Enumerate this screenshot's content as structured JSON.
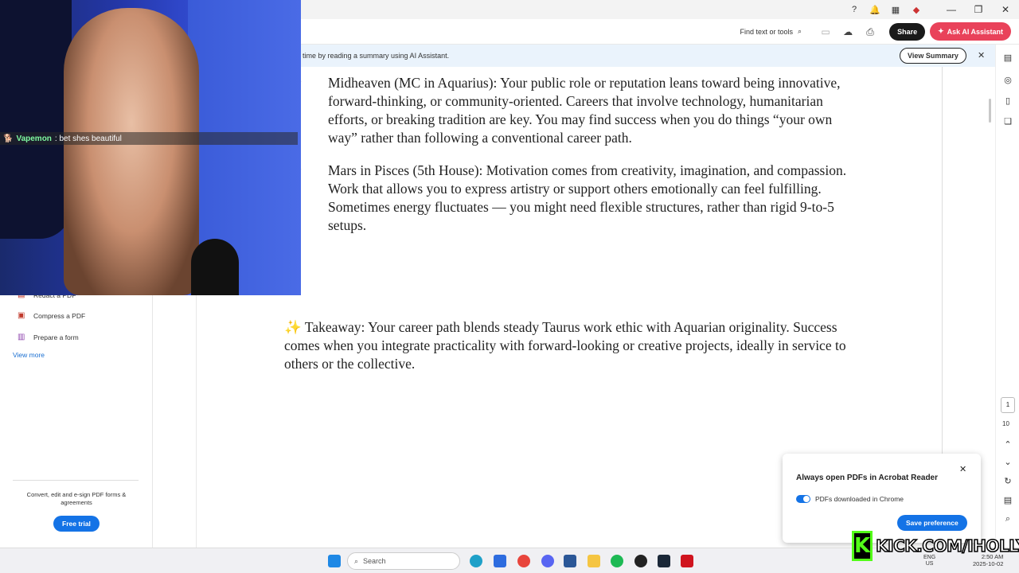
{
  "toolbar": {
    "find_label": "Find text or tools",
    "share_label": "Share",
    "ai_label": "Ask AI Assistant"
  },
  "banner": {
    "text": "time by reading a summary using AI Assistant.",
    "view_summary": "View Summary"
  },
  "left_panel": {
    "items": [
      {
        "label": "Redact a PDF"
      },
      {
        "label": "Compress a PDF"
      },
      {
        "label": "Prepare a form"
      }
    ],
    "view_more": "View more",
    "promo": "Convert, edit and e-sign PDF forms & agreements",
    "free_trial": "Free trial"
  },
  "document": {
    "midheaven": "Midheaven (MC in Aquarius): Your public role or reputation leans toward being innovative, forward-thinking, or community-oriented. Careers that involve technology, humanitarian efforts, or breaking tradition are key. You may find success when you do things “your own way” rather than following a conventional career path.",
    "mars": "Mars in Pisces (5th House): Motivation comes from creativity, imagination, and compassion. Work that allows you to express artistry or support others emotionally can feel fulfilling. Sometimes energy fluctuates — you might need flexible structures, rather than rigid 9-to-5 setups.",
    "takeaway": "✨ Takeaway: Your career path blends steady Taurus work ethic with Aquarian originality. Success comes when you integrate practicality with forward-looking or creative projects, ideally in service to others or the collective."
  },
  "pager": {
    "current": "1",
    "total": "10"
  },
  "chat": {
    "user": "Vapemon",
    "message": ": bet shes beautiful"
  },
  "popup": {
    "title": "Always open PDFs in Acrobat Reader",
    "toggle_label": "PDFs downloaded in Chrome",
    "toggle_on": true,
    "save_label": "Save preference"
  },
  "watermark": {
    "logo": "K",
    "text": "KICK.COM/IHOLLY"
  },
  "taskbar": {
    "search_placeholder": "Search",
    "lang_line1": "ENG",
    "lang_line2": "US",
    "time": "2:50 AM",
    "date": "2025-10-02"
  },
  "colors": {
    "accent": "#1473e6",
    "ai_button": "#e9425a",
    "kick_green": "#53fc18"
  }
}
